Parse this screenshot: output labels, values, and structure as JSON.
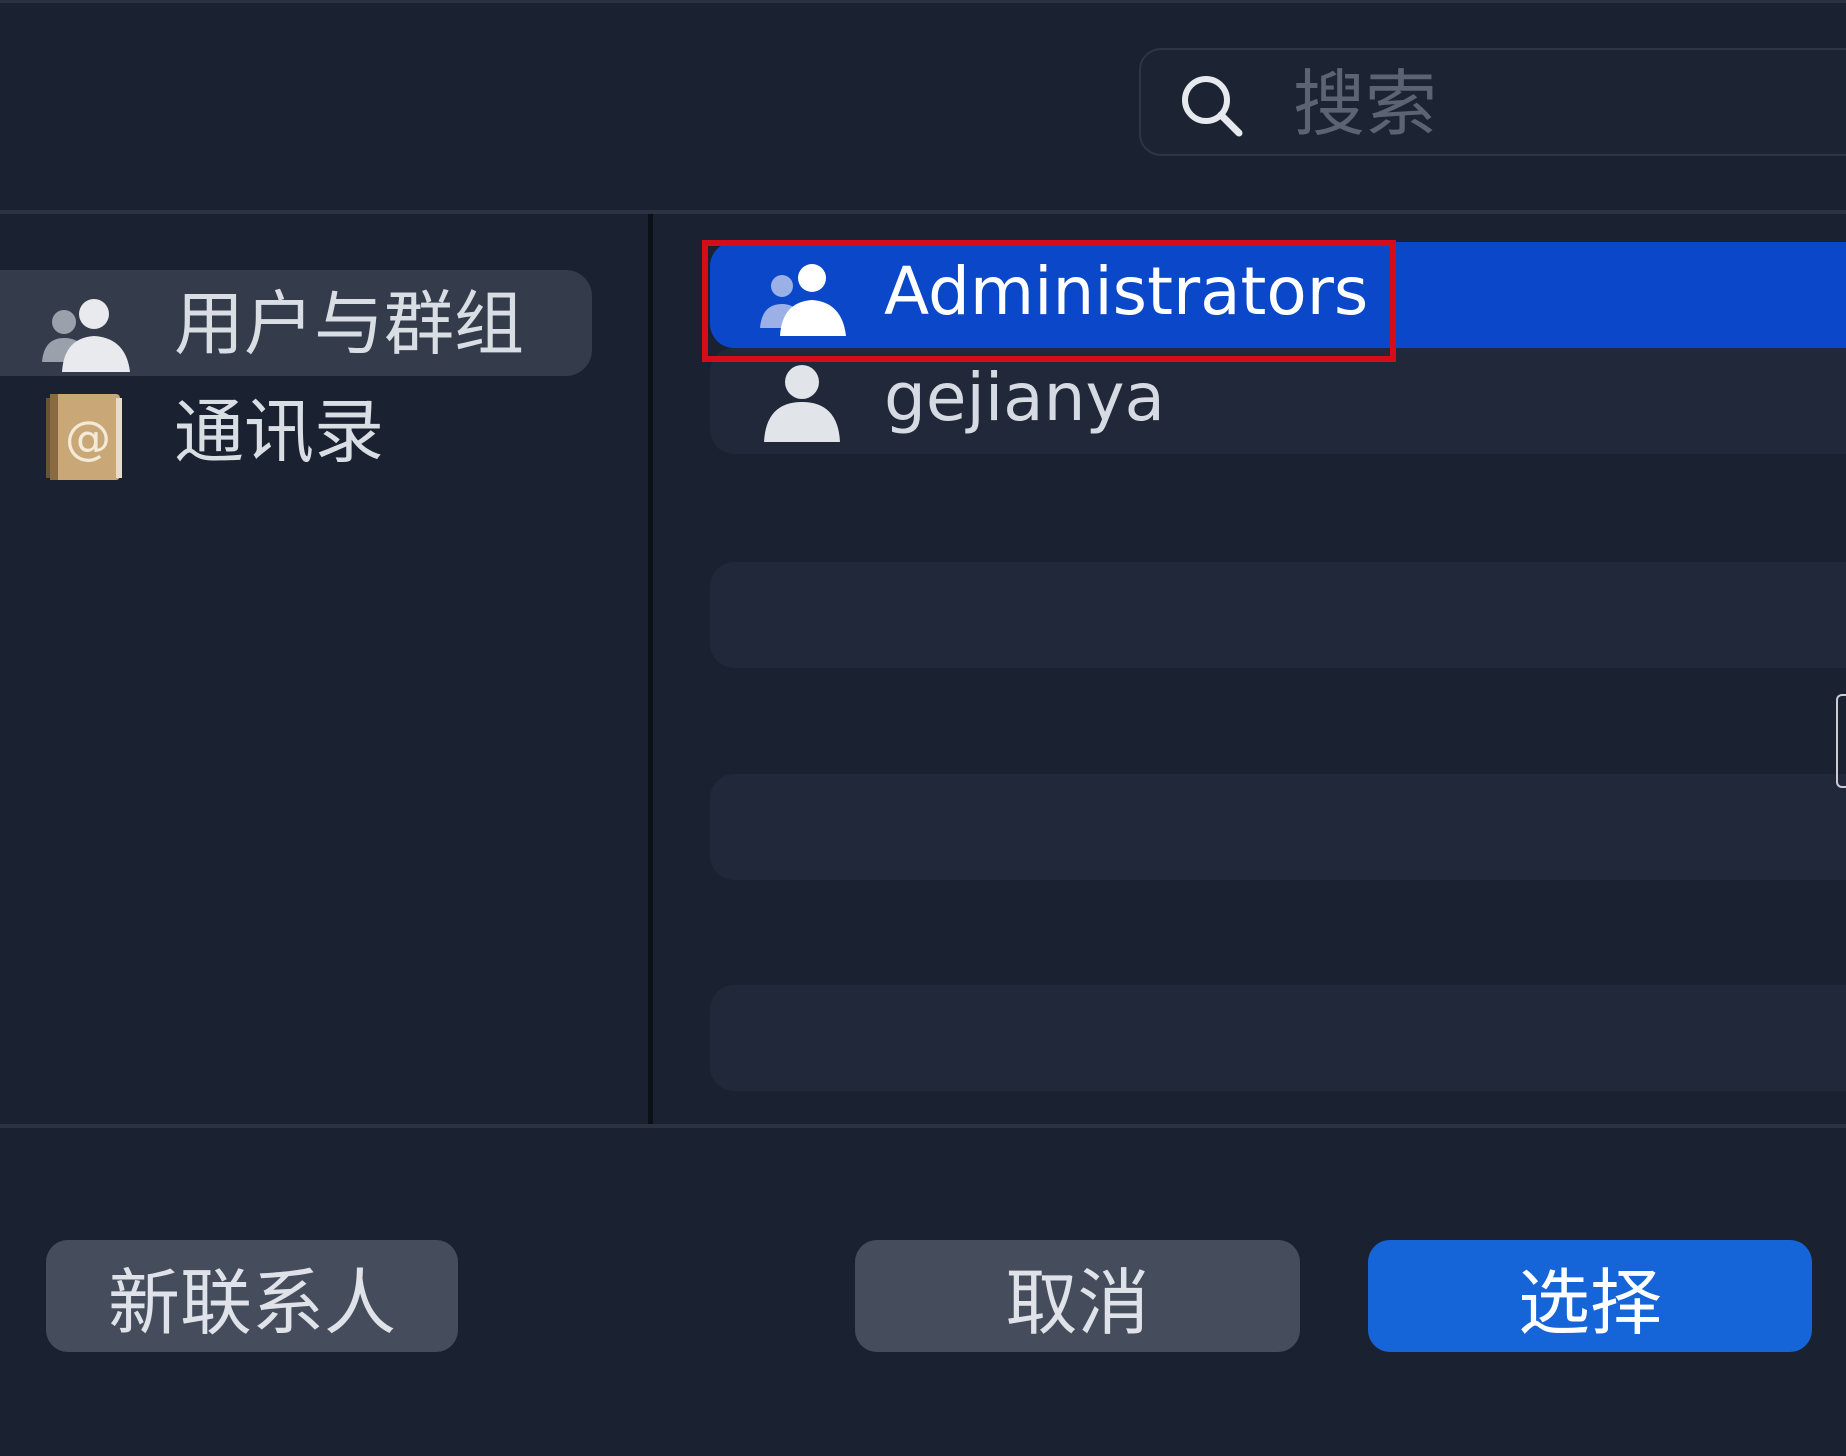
{
  "search": {
    "placeholder": "搜索"
  },
  "sidebar": {
    "items": [
      {
        "label": "用户与群组",
        "icon": "users-groups-icon",
        "selected": true
      },
      {
        "label": "通讯录",
        "icon": "address-book-icon",
        "selected": false
      }
    ]
  },
  "list": {
    "rows": [
      {
        "label": "Administrators",
        "icon": "group-icon",
        "selected": true
      },
      {
        "label": "gejianya",
        "icon": "user-icon",
        "selected": false
      }
    ]
  },
  "buttons": {
    "new_contact": "新联系人",
    "cancel": "取消",
    "choose": "选择"
  },
  "colors": {
    "background": "#1a2130",
    "selection_blue": "#0b47c9",
    "primary_button": "#1565d8",
    "highlight_red": "#d50d18"
  }
}
